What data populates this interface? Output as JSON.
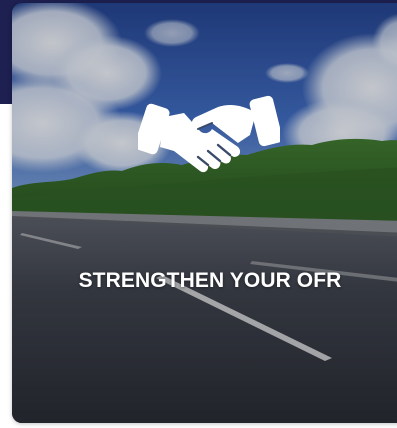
{
  "header": {
    "band_color": "#1d2050"
  },
  "card": {
    "title": "STRENGTHEN YOUR OFR",
    "icon": "handshake-icon",
    "background": "sky-forest-road-photo",
    "title_color": "#ffffff"
  }
}
